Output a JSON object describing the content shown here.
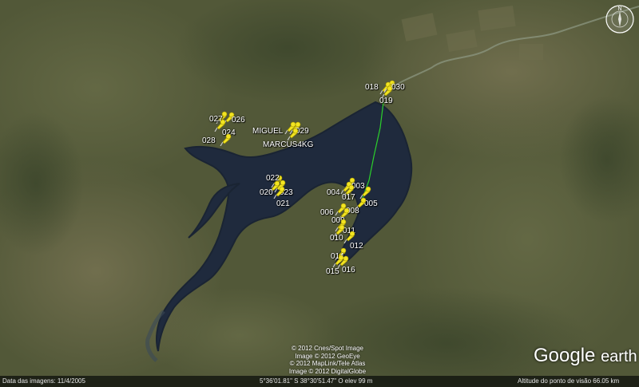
{
  "map": {
    "pins": [
      {
        "label": "018",
        "pin": [
          479,
          113
        ],
        "text": [
          457,
          104
        ]
      },
      {
        "label": "030",
        "pin": [
          484,
          111
        ],
        "text": [
          490,
          104
        ]
      },
      {
        "label": "019",
        "pin": [
          481,
          118
        ],
        "text": [
          475,
          121
        ]
      },
      {
        "label": "027",
        "pin": [
          274,
          150
        ],
        "text": [
          262,
          144
        ]
      },
      {
        "label": "026",
        "pin": [
          283,
          151
        ],
        "text": [
          290,
          145
        ]
      },
      {
        "label": "024",
        "pin": [
          272,
          160
        ],
        "text": [
          278,
          161
        ]
      },
      {
        "label": "028",
        "pin": [
          279,
          178
        ],
        "text": [
          253,
          171
        ]
      },
      {
        "label": "MIGUEL",
        "pin": [
          360,
          163
        ],
        "text": [
          316,
          159
        ]
      },
      {
        "label": "029",
        "pin": [
          366,
          163
        ],
        "text": [
          370,
          159
        ]
      },
      {
        "label": "MARCUS4KG",
        "pin": [
          363,
          171
        ],
        "text": [
          329,
          176
        ]
      },
      {
        "label": "022",
        "pin": [
          343,
          230
        ],
        "text": [
          333,
          218
        ]
      },
      {
        "label": "020",
        "pin": [
          340,
          237
        ],
        "text": [
          325,
          236
        ]
      },
      {
        "label": "023",
        "pin": [
          347,
          236
        ],
        "text": [
          350,
          236
        ]
      },
      {
        "label": "021",
        "pin": [
          346,
          244
        ],
        "text": [
          346,
          250
        ]
      },
      {
        "label": "003",
        "pin": [
          434,
          233
        ],
        "text": [
          440,
          228
        ]
      },
      {
        "label": "004",
        "pin": [
          430,
          238
        ],
        "text": [
          409,
          236
        ]
      },
      {
        "label": "017",
        "pin": [
          433,
          242
        ],
        "text": [
          428,
          242
        ]
      },
      {
        "label": "005",
        "pin": [
          454,
          244
        ],
        "text": [
          456,
          250
        ]
      },
      {
        "label": "008",
        "pin": [
          448,
          258
        ],
        "text": [
          433,
          259
        ]
      },
      {
        "label": "006",
        "pin": [
          423,
          265
        ],
        "text": [
          401,
          261
        ]
      },
      {
        "label": "009",
        "pin": [
          427,
          271
        ],
        "text": [
          415,
          271
        ]
      },
      {
        "label": "011",
        "pin": [
          423,
          285
        ],
        "text": [
          429,
          284
        ]
      },
      {
        "label": "010",
        "pin": [
          421,
          292
        ],
        "text": [
          413,
          293
        ]
      },
      {
        "label": "012",
        "pin": [
          434,
          300
        ],
        "text": [
          438,
          303
        ]
      },
      {
        "label": "014",
        "pin": [
          423,
          321
        ],
        "text": [
          414,
          316
        ]
      },
      {
        "label": "015",
        "pin": [
          420,
          330
        ],
        "text": [
          408,
          335
        ]
      },
      {
        "label": "016",
        "pin": [
          426,
          331
        ],
        "text": [
          428,
          333
        ]
      }
    ]
  },
  "compass": {
    "north_label": "N"
  },
  "credits": {
    "line1": "© 2012 Cnes/Spot Image",
    "line2": "Image © 2012 GeoEye",
    "line3": "© 2012 MapLink/Tele Atlas",
    "line4": "Image © 2012 DigitalGlobe"
  },
  "logo": {
    "google": "Google",
    "earth": "earth"
  },
  "statusbar": {
    "imagery_date": "Data das imagens: 11/4/2005",
    "coordinates": "5°36'01.81\" S  38°30'51.47\" O  elev   99 m",
    "eye_altitude": "Altitude do ponto de visão   66.05 km"
  },
  "colors": {
    "pin": "#f2e422",
    "track": "#2bd12b",
    "water": "#1f2a3d"
  }
}
